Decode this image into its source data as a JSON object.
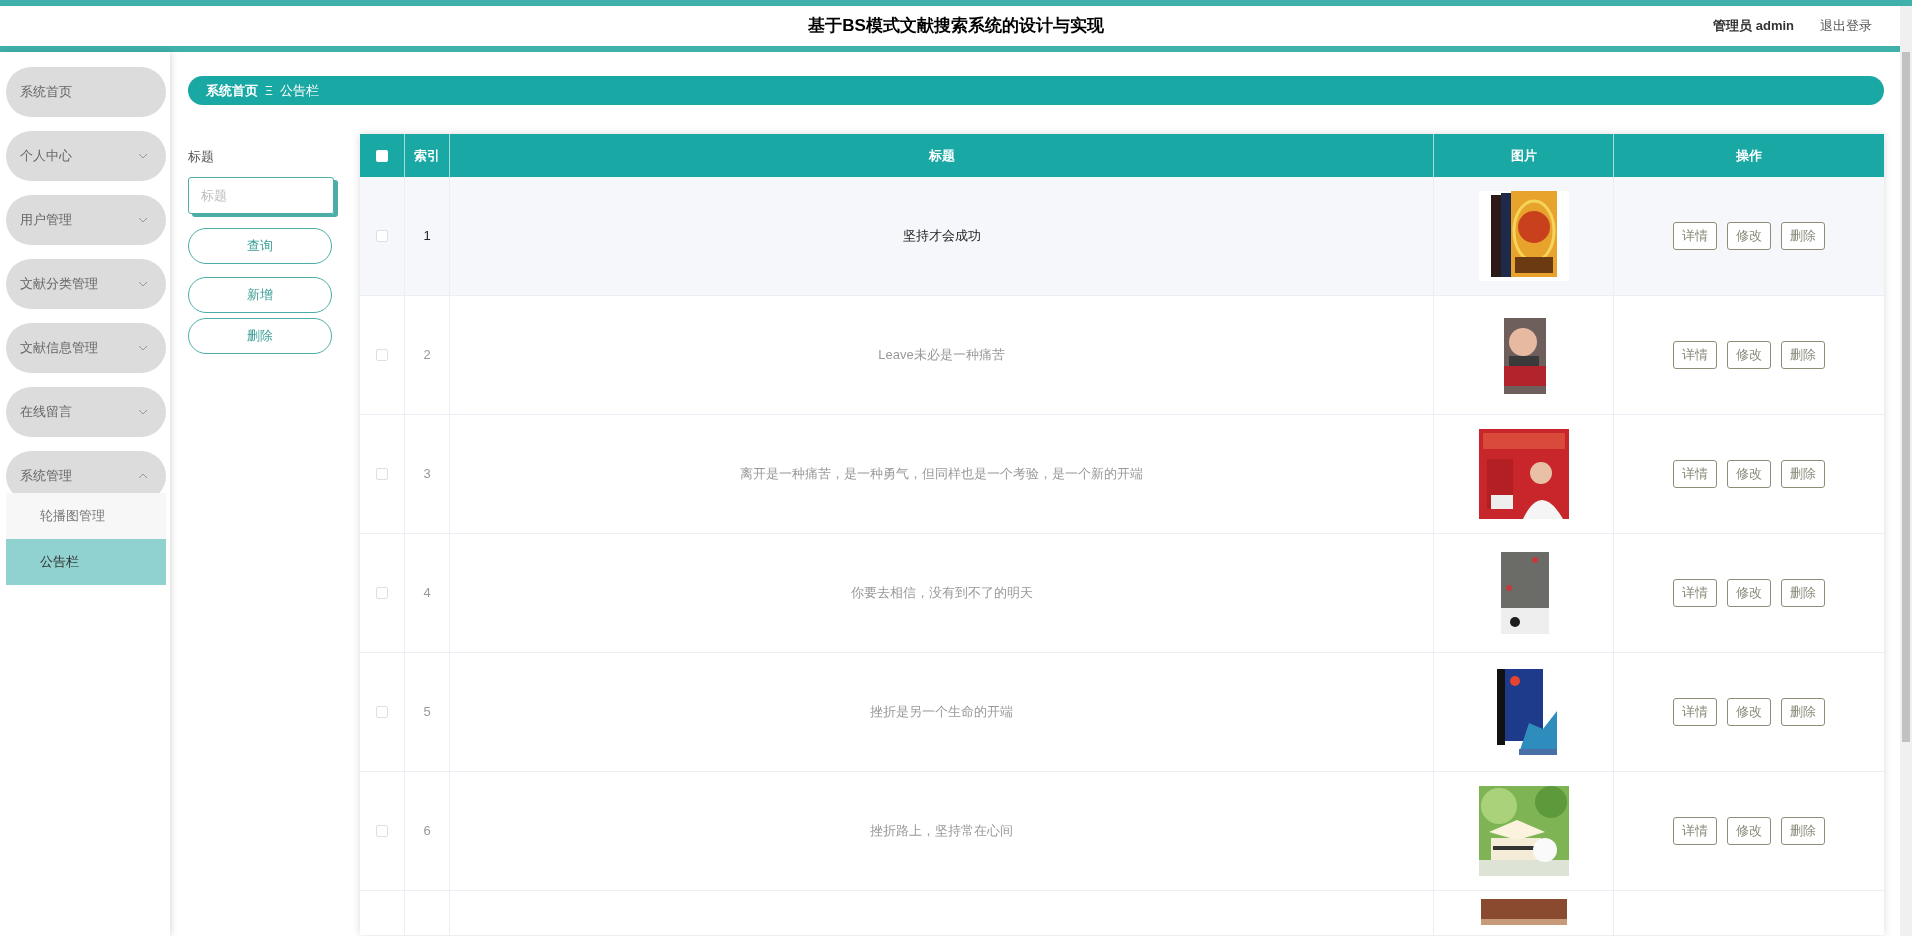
{
  "header": {
    "title": "基于BS模式文献搜索系统的设计与实现",
    "user": "管理员 admin",
    "logout": "退出登录"
  },
  "sidebar": {
    "items": [
      {
        "label": "系统首页",
        "kind": "link"
      },
      {
        "label": "个人中心",
        "kind": "menu",
        "expanded": false
      },
      {
        "label": "用户管理",
        "kind": "menu",
        "expanded": false
      },
      {
        "label": "文献分类管理",
        "kind": "menu",
        "expanded": false
      },
      {
        "label": "文献信息管理",
        "kind": "menu",
        "expanded": false
      },
      {
        "label": "在线留言",
        "kind": "menu",
        "expanded": false
      },
      {
        "label": "系统管理",
        "kind": "menu",
        "expanded": true,
        "children": [
          {
            "label": "轮播图管理",
            "selected": false
          },
          {
            "label": "公告栏",
            "selected": true
          }
        ]
      }
    ]
  },
  "breadcrumb": {
    "items": [
      "系统首页",
      "公告栏"
    ],
    "separator": "Ξ"
  },
  "search": {
    "label": "标题",
    "placeholder": "标题",
    "buttons": [
      "查询",
      "新增",
      "删除"
    ]
  },
  "table": {
    "select_all_checked": false,
    "columns": [
      "索引",
      "标题",
      "图片",
      "操作"
    ],
    "rows": [
      {
        "index": "1",
        "title": "坚持才会成功",
        "image": {
          "kind": "picture"
        },
        "hovered": true,
        "checked": false,
        "actions": [
          "详情",
          "修改",
          "删除"
        ]
      },
      {
        "index": "2",
        "title": "Leave未必是一种痛苦",
        "image": {
          "kind": "picture"
        },
        "hovered": false,
        "checked": false,
        "actions": [
          "详情",
          "修改",
          "删除"
        ]
      },
      {
        "index": "3",
        "title": "离开是一种痛苦，是一种勇气，但同样也是一个考验，是一个新的开端",
        "image": {
          "kind": "picture"
        },
        "hovered": false,
        "checked": false,
        "actions": [
          "详情",
          "修改",
          "删除"
        ]
      },
      {
        "index": "4",
        "title": "你要去相信，没有到不了的明天",
        "image": {
          "kind": "picture"
        },
        "hovered": false,
        "checked": false,
        "actions": [
          "详情",
          "修改",
          "删除"
        ]
      },
      {
        "index": "5",
        "title": "挫折是另一个生命的开端",
        "image": {
          "kind": "picture"
        },
        "hovered": false,
        "checked": false,
        "actions": [
          "详情",
          "修改",
          "删除"
        ]
      },
      {
        "index": "6",
        "title": "挫折路上，坚持常在心间",
        "image": {
          "kind": "picture"
        },
        "hovered": false,
        "checked": false,
        "actions": [
          "详情",
          "修改",
          "删除"
        ]
      },
      {
        "image": {
          "kind": "picture"
        }
      }
    ]
  }
}
